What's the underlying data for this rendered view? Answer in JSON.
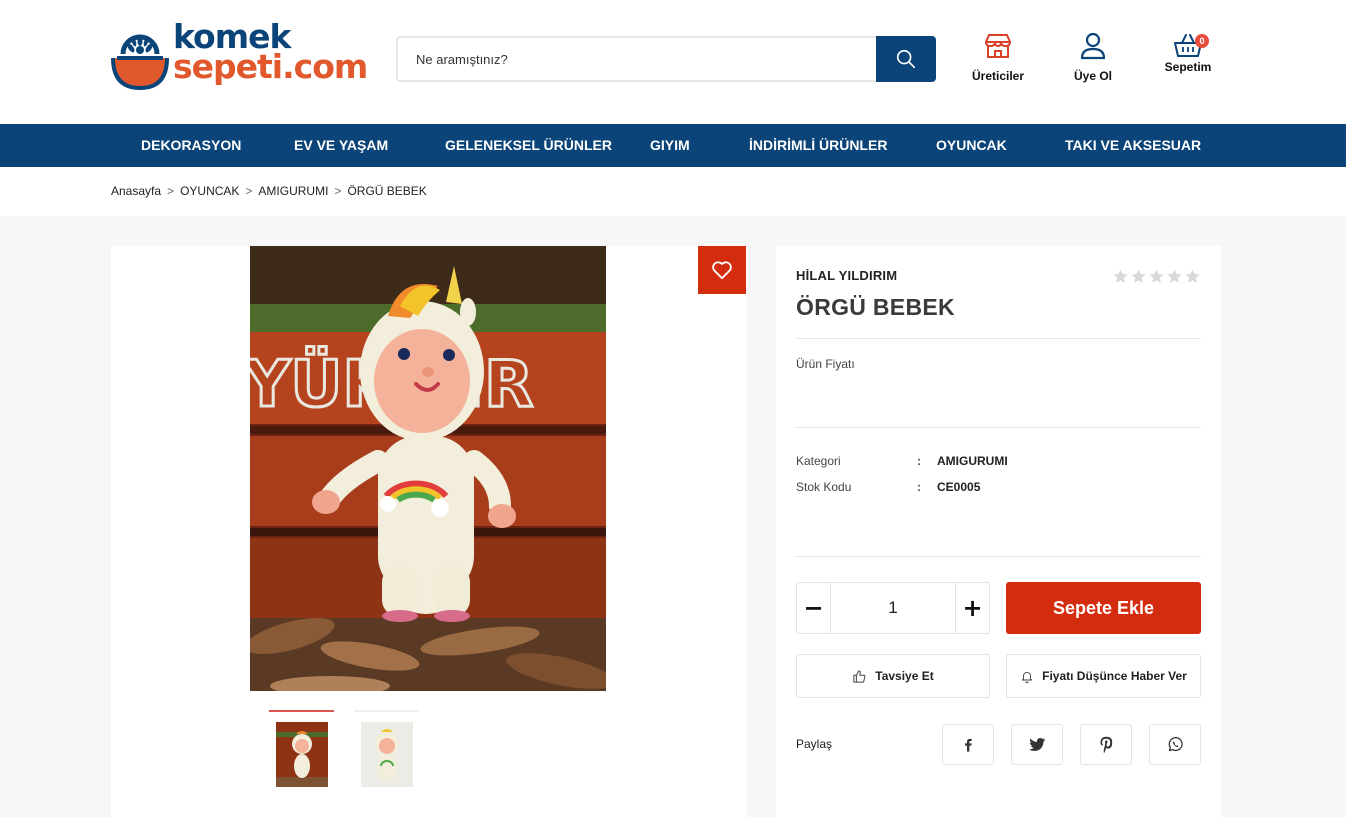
{
  "brand": {
    "line1": "komek",
    "line2": "sepeti.com"
  },
  "search": {
    "placeholder": "Ne aramıştınız?"
  },
  "header_links": {
    "producers": "Üreticiler",
    "signup": "Üye Ol",
    "cart": "Sepetim",
    "cart_count": "0"
  },
  "nav": [
    "DEKORASYON",
    "EV VE YAŞAM",
    "GELENEKSEL ÜRÜNLER",
    "GIYIM",
    "İNDİRİMLİ ÜRÜNLER",
    "OYUNCAK",
    "TAKI VE AKSESUAR"
  ],
  "breadcrumb": [
    "Anasayfa",
    "OYUNCAK",
    "AMIGURUMI",
    "ÖRGÜ BEBEK"
  ],
  "breadcrumb_sep": ">",
  "product": {
    "seller": "HİLAL YILDIRIM",
    "title": "ÖRGÜ BEBEK",
    "rating": 0,
    "rating_max": 5,
    "price_label": "Ürün Fiyatı",
    "category_label": "Kategori",
    "category_value": "AMIGURUMI",
    "sku_label": "Stok Kodu",
    "sku_value": "CE0005",
    "colon": ":",
    "image_text": "YÜKS  İR"
  },
  "cart_form": {
    "quantity": "1",
    "minus": "−",
    "plus": "+",
    "add_to_cart": "Sepete Ekle",
    "recommend": "Tavsiye Et",
    "price_alert": "Fiyatı Düşünce Haber Ver"
  },
  "share": {
    "label": "Paylaş",
    "networks": [
      "facebook",
      "twitter",
      "pinterest",
      "whatsapp"
    ]
  },
  "colors": {
    "primary": "#0b4478",
    "accent": "#d32c0e",
    "logo_orange": "#e0582b"
  }
}
